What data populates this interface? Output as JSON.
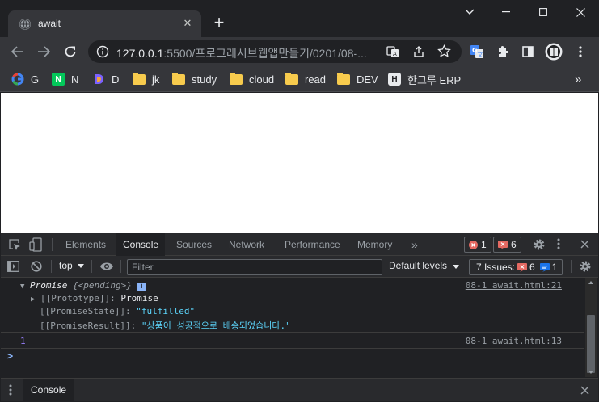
{
  "window": {
    "tab_title": "await"
  },
  "toolbar": {
    "url_host": "127.0.0.1",
    "url_rest": ":5500/프로그래시브웹앱만들기/0201/08-..."
  },
  "bookmarks": [
    {
      "label": "G",
      "icon": "google-icon"
    },
    {
      "label": "N",
      "icon": "naver-icon"
    },
    {
      "label": "D",
      "icon": "d-icon"
    },
    {
      "label": "jk",
      "icon": "folder-icon"
    },
    {
      "label": "study",
      "icon": "folder-icon"
    },
    {
      "label": "cloud",
      "icon": "folder-icon"
    },
    {
      "label": "read",
      "icon": "folder-icon"
    },
    {
      "label": "DEV",
      "icon": "folder-icon"
    },
    {
      "label": "한그루 ERP",
      "icon": "h-icon"
    }
  ],
  "bookmarks_more": "»",
  "devtools": {
    "tabs": [
      "Elements",
      "Console",
      "Sources",
      "Network",
      "Performance",
      "Memory"
    ],
    "more_tabs": "»",
    "errors_count": "1",
    "warnings_count": "6",
    "context": "top",
    "filter_placeholder": "Filter",
    "levels": "Default levels",
    "issues_label": "7 Issues:",
    "issues_errors": "6",
    "issues_info": "1",
    "drawer_tab": "Console"
  },
  "console": {
    "promise_head": "Promise",
    "promise_state_tag": "{<pending>}",
    "prototype_key": "[[Prototype]]",
    "prototype_val": "Promise",
    "state_key": "[[PromiseState]]",
    "state_val": "\"fulfilled\"",
    "result_key": "[[PromiseResult]]",
    "result_val": "\"상품이 성공적으로 배송되었습니다.\"",
    "source1": "08-1 await.html:21",
    "log_value": "1",
    "source2": "08-1 await.html:13",
    "prompt": ">"
  }
}
